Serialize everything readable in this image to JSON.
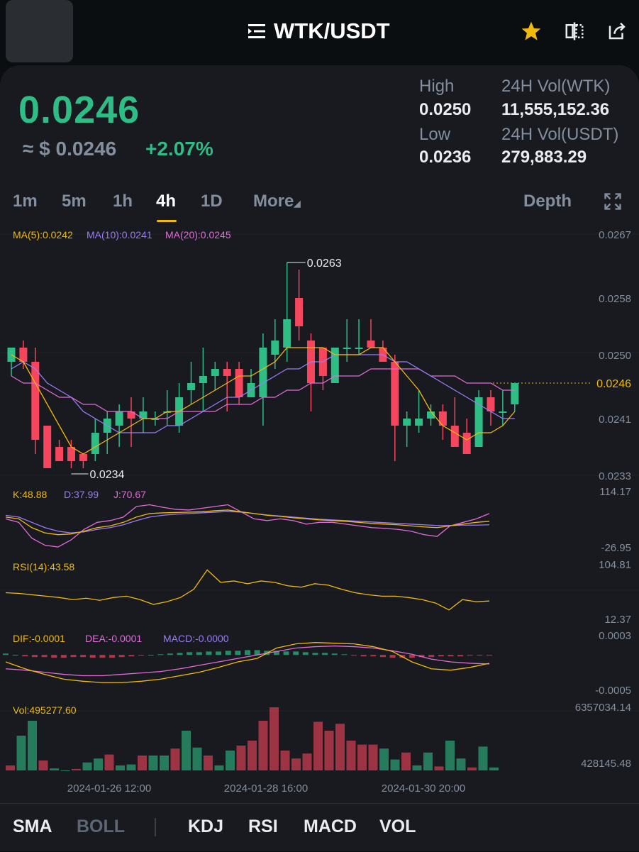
{
  "header": {
    "pair": "WTK/USDT"
  },
  "ticker": {
    "price": "0.0246",
    "usd_price": "≈ $ 0.0246",
    "change": "+2.07%",
    "high_label": "High",
    "high": "0.0250",
    "low_label": "Low",
    "low": "0.0236",
    "vol_base_label": "24H Vol(WTK)",
    "vol_base": "11,555,152.36",
    "vol_quote_label": "24H Vol(USDT)",
    "vol_quote": "279,883.29"
  },
  "intervals": [
    "1m",
    "5m",
    "1h",
    "4h",
    "1D",
    "More"
  ],
  "active_interval": "4h",
  "depth_label": "Depth",
  "colors": {
    "up": "#2ebd85",
    "down": "#f6465d",
    "ma5": "#f0b90b",
    "ma10": "#9b7cf6",
    "ma20": "#e36bd8",
    "muted": "#848e9c"
  },
  "chart_data": {
    "type": "candlestick",
    "dates_labels": [
      "2024-01-26 12:00",
      "2024-01-28 16:00",
      "2024-01-30 20:00"
    ],
    "price_axis": [
      "0.0267",
      "0.0258",
      "0.0250",
      "0.0246",
      "0.0241",
      "0.0233"
    ],
    "current_price": "0.0246",
    "high_marker": "0.0263",
    "low_marker": "0.0234",
    "ma_legend": [
      "MA(5):0.0242",
      "MA(10):0.0241",
      "MA(20):0.0245"
    ],
    "candles": [
      {
        "o": 0.0249,
        "h": 0.0251,
        "l": 0.0247,
        "c": 0.0251
      },
      {
        "o": 0.0251,
        "h": 0.0252,
        "l": 0.0248,
        "c": 0.0249
      },
      {
        "o": 0.0249,
        "h": 0.0251,
        "l": 0.0236,
        "c": 0.0238
      },
      {
        "o": 0.024,
        "h": 0.024,
        "l": 0.0234,
        "c": 0.0234
      },
      {
        "o": 0.0237,
        "h": 0.0238,
        "l": 0.0235,
        "c": 0.0235
      },
      {
        "o": 0.0237,
        "h": 0.0238,
        "l": 0.0234,
        "c": 0.0235
      },
      {
        "o": 0.0236,
        "h": 0.0236,
        "l": 0.0234,
        "c": 0.0235
      },
      {
        "o": 0.0236,
        "h": 0.0241,
        "l": 0.0235,
        "c": 0.0239
      },
      {
        "o": 0.0239,
        "h": 0.0242,
        "l": 0.0236,
        "c": 0.0241
      },
      {
        "o": 0.024,
        "h": 0.0243,
        "l": 0.0237,
        "c": 0.0242
      },
      {
        "o": 0.0242,
        "h": 0.0244,
        "l": 0.0237,
        "c": 0.0241
      },
      {
        "o": 0.0241,
        "h": 0.0244,
        "l": 0.0239,
        "c": 0.0242
      },
      {
        "o": 0.0241,
        "h": 0.0242,
        "l": 0.024,
        "c": 0.0241
      },
      {
        "o": 0.0242,
        "h": 0.0245,
        "l": 0.024,
        "c": 0.0242
      },
      {
        "o": 0.024,
        "h": 0.0246,
        "l": 0.0239,
        "c": 0.0244
      },
      {
        "o": 0.0245,
        "h": 0.0249,
        "l": 0.0243,
        "c": 0.0246
      },
      {
        "o": 0.0246,
        "h": 0.0251,
        "l": 0.0242,
        "c": 0.0247
      },
      {
        "o": 0.0247,
        "h": 0.0249,
        "l": 0.0245,
        "c": 0.0248
      },
      {
        "o": 0.0248,
        "h": 0.0249,
        "l": 0.0242,
        "c": 0.0247
      },
      {
        "o": 0.0248,
        "h": 0.0249,
        "l": 0.0243,
        "c": 0.0244
      },
      {
        "o": 0.0244,
        "h": 0.0248,
        "l": 0.0244,
        "c": 0.0246
      },
      {
        "o": 0.0244,
        "h": 0.0253,
        "l": 0.024,
        "c": 0.0251
      },
      {
        "o": 0.025,
        "h": 0.0255,
        "l": 0.0248,
        "c": 0.0252
      },
      {
        "o": 0.0251,
        "h": 0.0263,
        "l": 0.0249,
        "c": 0.0255
      },
      {
        "o": 0.0258,
        "h": 0.0262,
        "l": 0.0252,
        "c": 0.0254
      },
      {
        "o": 0.0252,
        "h": 0.0253,
        "l": 0.0242,
        "c": 0.0246
      },
      {
        "o": 0.0251,
        "h": 0.0251,
        "l": 0.0245,
        "c": 0.0247
      },
      {
        "o": 0.0246,
        "h": 0.0251,
        "l": 0.0247,
        "c": 0.0251
      },
      {
        "o": 0.0251,
        "h": 0.0255,
        "l": 0.0249,
        "c": 0.0251
      },
      {
        "o": 0.0251,
        "h": 0.0255,
        "l": 0.025,
        "c": 0.0251
      },
      {
        "o": 0.0252,
        "h": 0.0255,
        "l": 0.0251,
        "c": 0.0251
      },
      {
        "o": 0.0251,
        "h": 0.0252,
        "l": 0.0249,
        "c": 0.0249
      },
      {
        "o": 0.0249,
        "h": 0.025,
        "l": 0.0235,
        "c": 0.024
      },
      {
        "o": 0.024,
        "h": 0.0242,
        "l": 0.0237,
        "c": 0.0241
      },
      {
        "o": 0.024,
        "h": 0.0245,
        "l": 0.0239,
        "c": 0.0241
      },
      {
        "o": 0.0241,
        "h": 0.0243,
        "l": 0.024,
        "c": 0.0242
      },
      {
        "o": 0.0242,
        "h": 0.0243,
        "l": 0.0238,
        "c": 0.024
      },
      {
        "o": 0.024,
        "h": 0.0244,
        "l": 0.0237,
        "c": 0.0237
      },
      {
        "o": 0.0239,
        "h": 0.0241,
        "l": 0.0236,
        "c": 0.0236
      },
      {
        "o": 0.0237,
        "h": 0.0245,
        "l": 0.0237,
        "c": 0.0244
      },
      {
        "o": 0.0244,
        "h": 0.0245,
        "l": 0.024,
        "c": 0.0242
      },
      {
        "o": 0.0242,
        "h": 0.0245,
        "l": 0.024,
        "c": 0.0242
      },
      {
        "o": 0.0243,
        "h": 0.0246,
        "l": 0.0242,
        "c": 0.0246
      }
    ],
    "ma5": [
      0.025,
      0.0249,
      0.0246,
      0.0243,
      0.024,
      0.0237,
      0.0236,
      0.0237,
      0.0238,
      0.0239,
      0.024,
      0.0241,
      0.0241,
      0.0242,
      0.0242,
      0.0243,
      0.0244,
      0.0245,
      0.0246,
      0.0247,
      0.0247,
      0.0248,
      0.0249,
      0.0251,
      0.0251,
      0.0251,
      0.0251,
      0.025,
      0.025,
      0.025,
      0.0251,
      0.0251,
      0.0249,
      0.0247,
      0.0245,
      0.0242,
      0.024,
      0.0239,
      0.0238,
      0.0239,
      0.0239,
      0.024,
      0.0242
    ],
    "ma10": [
      0.0248,
      0.0249,
      0.0248,
      0.0246,
      0.0245,
      0.0244,
      0.0242,
      0.0241,
      0.024,
      0.0239,
      0.0239,
      0.0239,
      0.0239,
      0.024,
      0.024,
      0.0241,
      0.0242,
      0.0243,
      0.0244,
      0.0244,
      0.0245,
      0.0246,
      0.0247,
      0.0248,
      0.0248,
      0.0249,
      0.0249,
      0.025,
      0.025,
      0.025,
      0.025,
      0.025,
      0.0249,
      0.0249,
      0.0248,
      0.0247,
      0.0246,
      0.0245,
      0.0244,
      0.0243,
      0.0242,
      0.0241,
      0.0241
    ],
    "ma20": [
      0.0247,
      0.0246,
      0.0246,
      0.0245,
      0.0244,
      0.0244,
      0.0243,
      0.0243,
      0.0242,
      0.0242,
      0.0242,
      0.0241,
      0.0241,
      0.0241,
      0.0242,
      0.0242,
      0.0242,
      0.0242,
      0.0243,
      0.0243,
      0.0243,
      0.0244,
      0.0244,
      0.0245,
      0.0245,
      0.0246,
      0.0246,
      0.0247,
      0.0247,
      0.0247,
      0.0248,
      0.0248,
      0.0248,
      0.0248,
      0.0248,
      0.0247,
      0.0247,
      0.0247,
      0.0246,
      0.0246,
      0.0246,
      0.0245,
      0.0245
    ],
    "kdj": {
      "legend": [
        "K:48.88",
        "D:37.99",
        "J:70.67"
      ],
      "axis": [
        "114.17",
        "-26.95"
      ],
      "k": [
        60,
        55,
        30,
        15,
        10,
        12,
        20,
        30,
        35,
        45,
        60,
        70,
        72,
        73,
        74,
        75,
        78,
        80,
        75,
        70,
        65,
        62,
        58,
        55,
        52,
        50,
        48,
        45,
        42,
        40,
        38,
        35,
        32,
        30,
        35,
        40,
        45,
        48
      ],
      "d": [
        65,
        60,
        45,
        30,
        20,
        15,
        18,
        25,
        30,
        38,
        50,
        60,
        65,
        68,
        70,
        72,
        74,
        76,
        74,
        70,
        66,
        63,
        60,
        57,
        54,
        52,
        50,
        48,
        46,
        44,
        42,
        40,
        38,
        36,
        36,
        37,
        37,
        38
      ],
      "j": [
        55,
        45,
        0,
        -20,
        -25,
        -5,
        25,
        45,
        50,
        60,
        90,
        95,
        88,
        82,
        80,
        85,
        90,
        95,
        75,
        55,
        50,
        55,
        50,
        40,
        45,
        45,
        40,
        35,
        30,
        28,
        25,
        20,
        10,
        5,
        35,
        45,
        55,
        70
      ]
    },
    "rsi": {
      "legend": "RSI(14):43.58",
      "axis": [
        "104.81",
        "12.37"
      ],
      "values": [
        55,
        54,
        52,
        50,
        48,
        45,
        47,
        44,
        48,
        50,
        45,
        38,
        42,
        48,
        60,
        88,
        70,
        72,
        68,
        72,
        70,
        65,
        63,
        68,
        66,
        60,
        55,
        52,
        50,
        50,
        48,
        45,
        40,
        30,
        45,
        42,
        43
      ]
    },
    "macd": {
      "legend": [
        "DIF:-0.0001",
        "DEA:-0.0001",
        "MACD:-0.0000"
      ],
      "axis": [
        "0.0003",
        "-0.0005"
      ],
      "dif": [
        -0.0001,
        -0.0002,
        -0.00028,
        -0.00035,
        -0.00038,
        -0.0004,
        -0.0004,
        -0.00038,
        -0.00035,
        -0.0003,
        -0.00025,
        -0.00018,
        -0.0001,
        -5e-05,
        0.0001,
        0.00016,
        0.00018,
        0.00017,
        0.00016,
        0.00012,
        5e-05,
        -0.0001,
        -0.0002,
        -0.00022,
        -0.00018,
        -0.00012
      ],
      "dea": [
        -0.0002,
        -0.00022,
        -0.00025,
        -0.00028,
        -0.0003,
        -0.0003,
        -0.00028,
        -0.00026,
        -0.00024,
        -0.0002,
        -0.00015,
        -0.0001,
        -5e-05,
        0,
        5e-05,
        0.0001,
        0.00012,
        0.00013,
        0.00012,
        0.0001,
        6e-05,
        1e-05,
        -6e-05,
        -0.0001,
        -0.00012,
        -0.00013
      ],
      "hist": [
        2e-05,
        0,
        -2e-05,
        -3e-05,
        -3e-05,
        -4e-05,
        -4e-05,
        -3e-05,
        -3e-05,
        -4e-05,
        -4e-05,
        -4e-05,
        -3e-05,
        -2e-05,
        -1e-05,
        0,
        1e-05,
        2e-05,
        3e-05,
        4e-05,
        4e-05,
        5e-05,
        5e-05,
        6e-05,
        6e-05,
        7e-05,
        7e-05,
        6e-05,
        6e-05,
        5e-05,
        5e-05,
        4e-05,
        3e-05,
        3e-05,
        2e-05,
        1e-05,
        -1e-05,
        -2e-05,
        -2e-05,
        -3e-05,
        -4e-05,
        -4e-05,
        -4e-05,
        -3e-05,
        -3e-05,
        -2e-05,
        -2e-05,
        -2e-05,
        -1e-05,
        -1e-05,
        -1e-05
      ]
    },
    "volume": {
      "legend": "Vol:495277.60",
      "axis": [
        "6357034.14",
        "428145.48"
      ],
      "values": [
        500000,
        3500000,
        5000000,
        1000000,
        200000,
        0,
        150000,
        800000,
        1200000,
        1600000,
        500000,
        600000,
        1500000,
        1500000,
        1500000,
        2200000,
        4000000,
        2300000,
        1500000,
        500000,
        2000000,
        2500000,
        3000000,
        5000000,
        6357034,
        2000000,
        1200000,
        1700000,
        4900000,
        4000000,
        4700000,
        3000000,
        2600000,
        2600000,
        2200000,
        1100000,
        1800000,
        500000,
        1800000,
        400000,
        3000000,
        1200000,
        300000,
        2400000,
        300000
      ]
    }
  },
  "bottom_tabs": [
    "SMA",
    "BOLL",
    "KDJ",
    "RSI",
    "MACD",
    "VOL"
  ]
}
